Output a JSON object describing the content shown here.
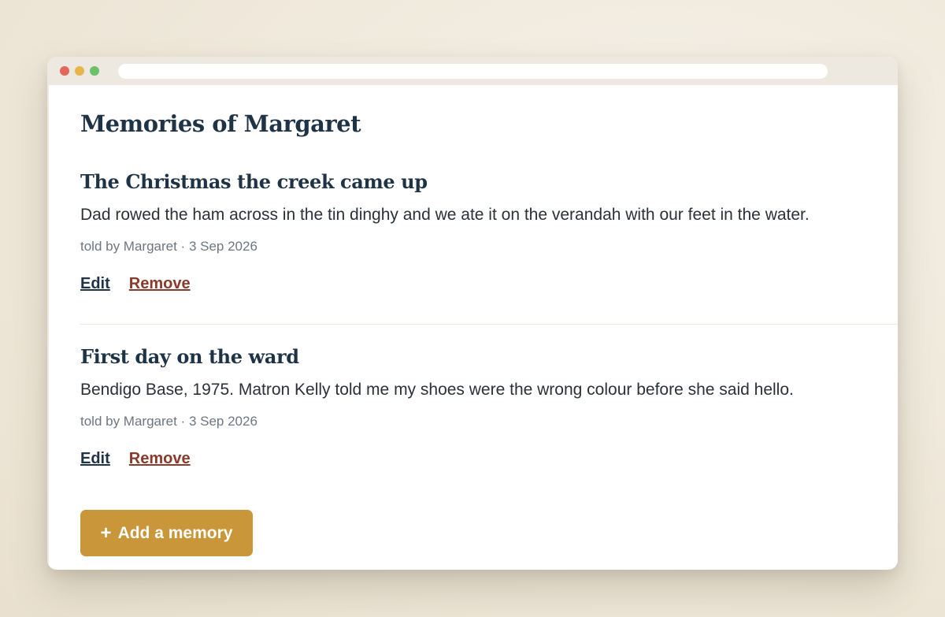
{
  "page": {
    "title": "Memories of Margaret"
  },
  "memories": [
    {
      "title": "The Christmas the creek came up",
      "body": "Dad rowed the ham across in the tin dinghy and we ate it on the verandah with our feet in the water.",
      "meta": "told by Margaret · 3 Sep 2026",
      "edit_label": "Edit",
      "remove_label": "Remove"
    },
    {
      "title": "First day on the ward",
      "body": "Bendigo Base, 1975. Matron Kelly told me my shoes were the wrong colour before she said hello.",
      "meta": "told by Margaret · 3 Sep 2026",
      "edit_label": "Edit",
      "remove_label": "Remove"
    }
  ],
  "add_button": {
    "icon": "+",
    "label": "Add a memory"
  },
  "colors": {
    "heading": "#1f3347",
    "remove": "#8a3a2a",
    "accent": "#c9963a"
  },
  "icons": {
    "add": "plus-icon"
  }
}
